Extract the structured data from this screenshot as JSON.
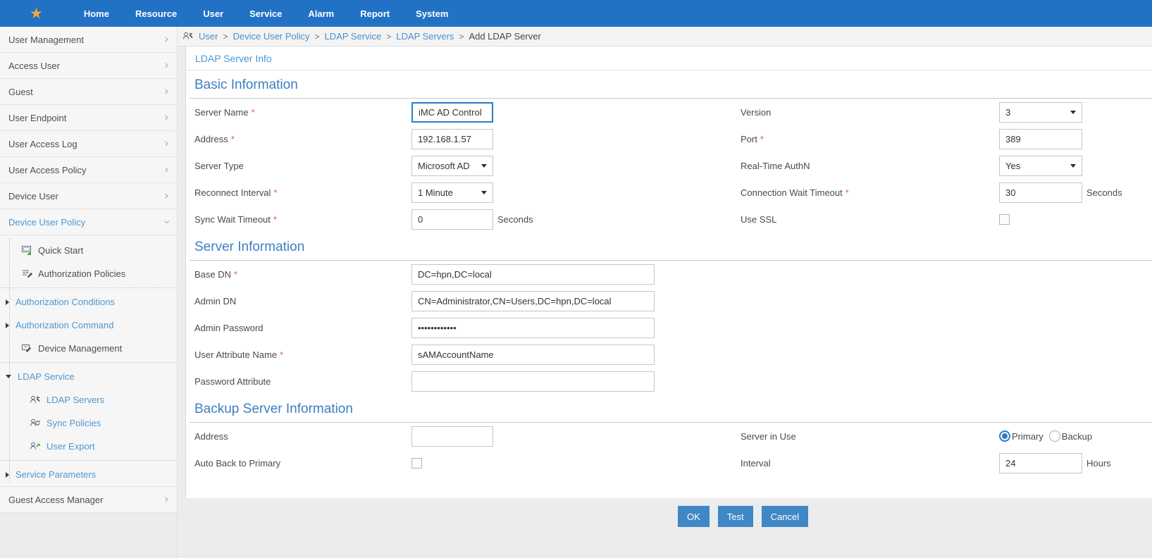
{
  "colors": {
    "nav_blue": "#2171c5",
    "link_blue": "#4a90cc",
    "heading_blue": "#3e7fc2",
    "active_item_blue": "#4e97d1",
    "button_blue": "#3f87c5",
    "star_orange": "#f2a736",
    "required_red": "#e05c51",
    "focused_border_blue": "#2a7cc9"
  },
  "nav": {
    "items": [
      "Home",
      "Resource",
      "User",
      "Service",
      "Alarm",
      "Report",
      "System"
    ]
  },
  "sidebar": {
    "items": [
      "User Management",
      "Access User",
      "Guest",
      "User Endpoint",
      "User Access Log",
      "User Access Policy",
      "Device User",
      "Device User Policy"
    ],
    "submenu": {
      "quick_start": "Quick Start",
      "authorization_policies": "Authorization Policies",
      "authorization_conditions": "Authorization Conditions",
      "authorization_command": "Authorization Command",
      "device_management": "Device Management",
      "ldap_service": "LDAP Service",
      "ldap_servers": "LDAP Servers",
      "sync_policies": "Sync Policies",
      "user_export": "User Export",
      "service_parameters": "Service Parameters"
    },
    "guest_access_manager": "Guest Access Manager"
  },
  "breadcrumb": {
    "separator": ">",
    "links": [
      "User",
      "Device User Policy",
      "LDAP Service",
      "LDAP Servers"
    ],
    "current": "Add LDAP Server"
  },
  "panel": {
    "title": "LDAP Server Info"
  },
  "form": {
    "basic": {
      "heading": "Basic Information",
      "server_name": {
        "label": "Server Name",
        "required": "*",
        "value": "iMC AD Control"
      },
      "version": {
        "label": "Version",
        "value": "3"
      },
      "address": {
        "label": "Address",
        "required": "*",
        "value": "192.168.1.57"
      },
      "port": {
        "label": "Port",
        "required": "*",
        "value": "389"
      },
      "server_type": {
        "label": "Server Type",
        "value": "Microsoft AD"
      },
      "real_time_authn": {
        "label": "Real-Time AuthN",
        "value": "Yes"
      },
      "reconnect_interval": {
        "label": "Reconnect Interval",
        "required": "*",
        "value": "1 Minute"
      },
      "connection_wait_timeout": {
        "label": "Connection Wait Timeout",
        "required": "*",
        "value": "30",
        "unit": "Seconds"
      },
      "sync_wait_timeout": {
        "label": "Sync Wait Timeout",
        "required": "*",
        "value": "0",
        "unit": "Seconds"
      },
      "use_ssl": {
        "label": "Use SSL",
        "checked": false
      }
    },
    "server": {
      "heading": "Server Information",
      "base_dn": {
        "label": "Base DN",
        "required": "*",
        "value": "DC=hpn,DC=local"
      },
      "admin_dn": {
        "label": "Admin DN",
        "value": "CN=Administrator,CN=Users,DC=hpn,DC=local"
      },
      "admin_password": {
        "label": "Admin Password",
        "value": "••••••••••••"
      },
      "user_attribute_name": {
        "label": "User Attribute Name",
        "required": "*",
        "value": "sAMAccountName"
      },
      "password_attribute": {
        "label": "Password Attribute",
        "value": ""
      }
    },
    "backup": {
      "heading": "Backup Server Information",
      "address": {
        "label": "Address",
        "value": ""
      },
      "server_in_use": {
        "label": "Server in Use",
        "options": [
          "Primary",
          "Backup"
        ],
        "selected": "Primary"
      },
      "auto_back_to_primary": {
        "label": "Auto Back to Primary",
        "checked": false
      },
      "interval": {
        "label": "Interval",
        "value": "24",
        "unit": "Hours"
      }
    }
  },
  "footer": {
    "ok": "OK",
    "test": "Test",
    "cancel": "Cancel"
  }
}
